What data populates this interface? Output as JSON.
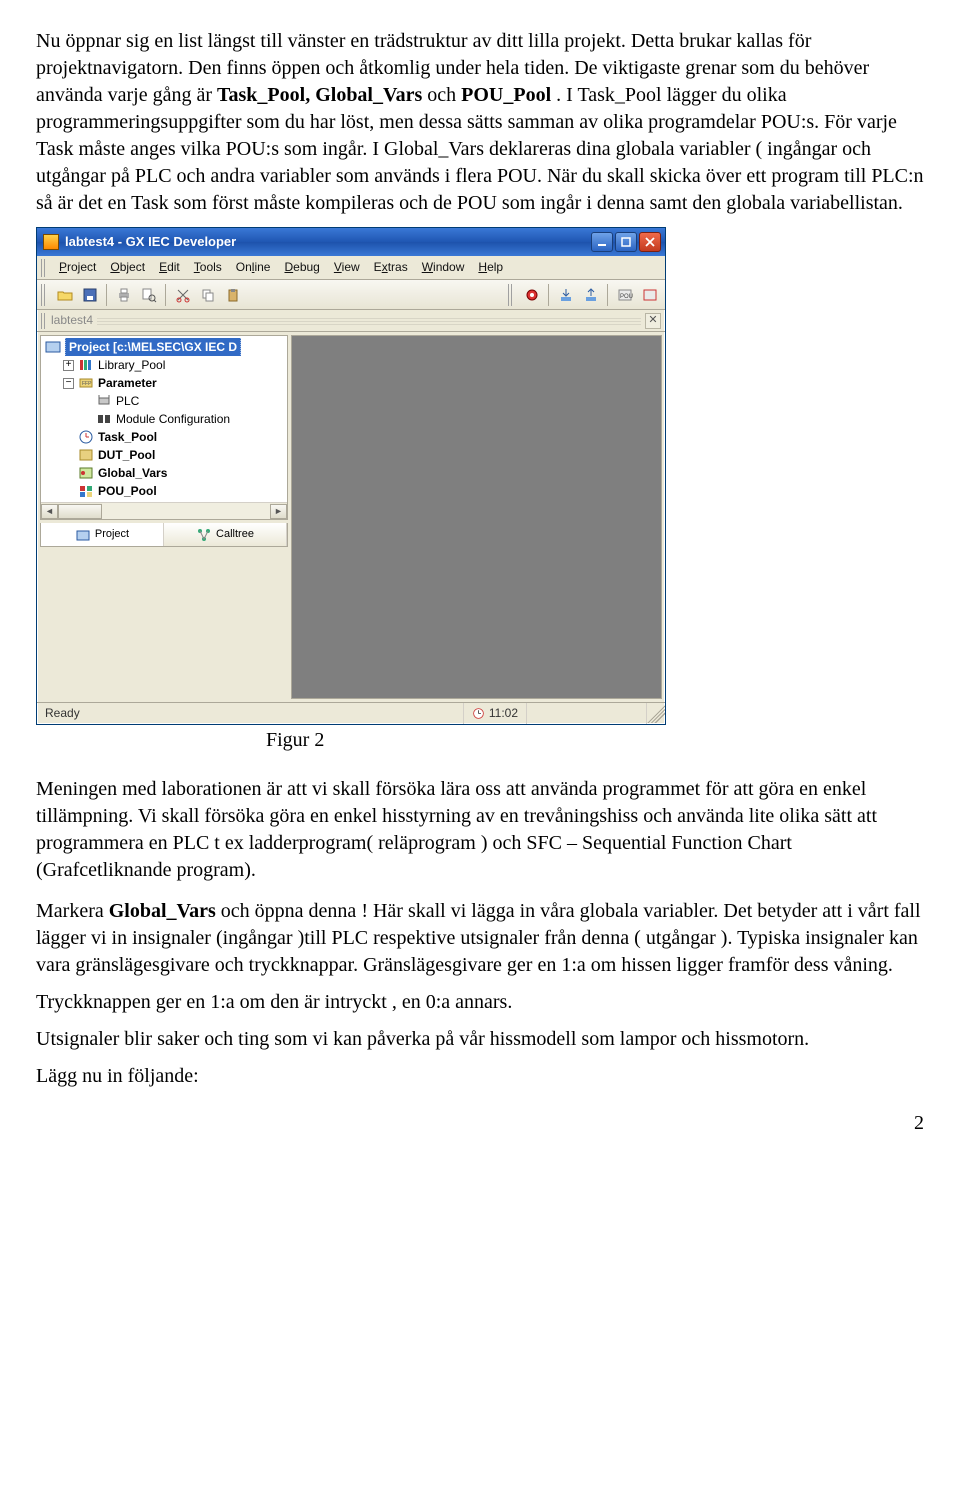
{
  "doc": {
    "p1": "Nu öppnar sig en list längst till vänster en trädstruktur av ditt lilla projekt. Detta brukar kallas för projektnavigatorn. Den finns öppen och åtkomlig under hela tiden. De viktigaste grenar som du behöver använda varje gång är ",
    "p1_b1": "Task_Pool, Global_Vars",
    "p1_mid": " och ",
    "p1_b2": "POU_Pool",
    "p1_after": ". I Task_Pool lägger du olika programmeringsuppgifter som du har löst, men dessa sätts samman av olika programdelar POU:s. För varje Task måste anges vilka POU:s som ingår. I Global_Vars deklareras dina globala variabler ( ingångar och utgångar på PLC och andra variabler som används i flera POU. När du skall skicka över ett program till PLC:n så är det en Task som först måste kompileras och de POU som ingår i denna  samt den globala variabellistan.",
    "figcap": "Figur 2",
    "p2": "Meningen med laborationen är att vi skall försöka lära oss att använda programmet för att göra en enkel tillämpning. Vi skall försöka göra en enkel hisstyrning av en trevåningshiss och använda lite olika sätt att programmera en PLC  t ex ladderprogram( reläprogram ) och SFC – Sequential Function Chart (Grafcetliknande program).",
    "p3_a": "Markera ",
    "p3_b1": "Global_Vars",
    "p3_b": " och öppna denna",
    "p3_c": " ! Här skall vi lägga in våra globala variabler. Det betyder att i vårt fall lägger vi in insignaler (ingångar )till PLC respektive utsignaler från denna ( utgångar ). Typiska insignaler kan vara gränslägesgivare och tryckknappar. Gränslägesgivare ger en 1:a om hissen ligger framför dess våning.",
    "p4": "Tryckknappen ger en 1:a om den är intryckt , en 0:a annars.",
    "p5": "Utsignaler blir saker och ting som vi kan påverka på vår hissmodell som lampor och hissmotorn.",
    "p6": "Lägg nu in följande:",
    "pagenum": "2"
  },
  "app": {
    "title": "labtest4 - GX IEC Developer",
    "menus": [
      "Project",
      "Object",
      "Edit",
      "Tools",
      "Online",
      "Debug",
      "View",
      "Extras",
      "Window",
      "Help"
    ],
    "breadcrumb": "labtest4",
    "tree": {
      "root": "Project [c:\\MELSEC\\GX IEC D",
      "items": [
        {
          "label": "Library_Pool",
          "bold": false,
          "indent": 1,
          "icon": "lib",
          "exp": "+"
        },
        {
          "label": "Parameter",
          "bold": true,
          "indent": 1,
          "icon": "param",
          "exp": "-"
        },
        {
          "label": "PLC",
          "bold": false,
          "indent": 2,
          "icon": "plc",
          "exp": ""
        },
        {
          "label": "Module Configuration",
          "bold": false,
          "indent": 2,
          "icon": "mod",
          "exp": ""
        },
        {
          "label": "Task_Pool",
          "bold": true,
          "indent": 1,
          "icon": "clock",
          "exp": ""
        },
        {
          "label": "DUT_Pool",
          "bold": true,
          "indent": 1,
          "icon": "dut",
          "exp": ""
        },
        {
          "label": "Global_Vars",
          "bold": true,
          "indent": 1,
          "icon": "gvar",
          "exp": ""
        },
        {
          "label": "POU_Pool",
          "bold": true,
          "indent": 1,
          "icon": "pou",
          "exp": ""
        }
      ]
    },
    "side_tabs": {
      "project": "Project",
      "calltree": "Calltree"
    },
    "status": {
      "ready": "Ready",
      "time": "11:02"
    }
  }
}
